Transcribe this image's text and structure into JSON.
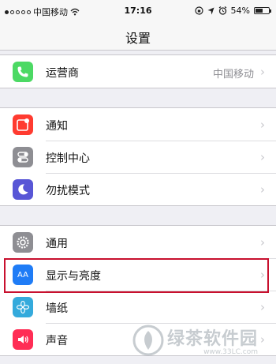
{
  "status_bar": {
    "carrier": "中国移动",
    "time": "17:16",
    "battery": "54%",
    "battery_level": 0.54
  },
  "nav": {
    "title": "设置"
  },
  "groups": [
    {
      "rows": [
        {
          "label": "运营商",
          "value": "中国移动",
          "icon": "phone-icon",
          "color": "#4cd964"
        }
      ]
    },
    {
      "rows": [
        {
          "label": "通知",
          "icon": "notifications-icon",
          "color": "#ff3b30"
        },
        {
          "label": "控制中心",
          "icon": "control-center-icon",
          "color": "#8e8e93"
        },
        {
          "label": "勿扰模式",
          "icon": "moon-icon",
          "color": "#5856d6"
        }
      ]
    },
    {
      "rows": [
        {
          "label": "通用",
          "icon": "gear-icon",
          "color": "#8e8e93"
        },
        {
          "label": "显示与亮度",
          "icon": "display-brightness-icon",
          "icon_text": "AA",
          "color": "#1f7cf6"
        },
        {
          "label": "墙纸",
          "icon": "wallpaper-icon",
          "color": "#34aadc"
        },
        {
          "label": "声音",
          "icon": "sound-icon",
          "color": "#ff2d55"
        }
      ]
    }
  ],
  "watermark": {
    "text": "绿茶软件园",
    "url": "www.33LC.com"
  }
}
